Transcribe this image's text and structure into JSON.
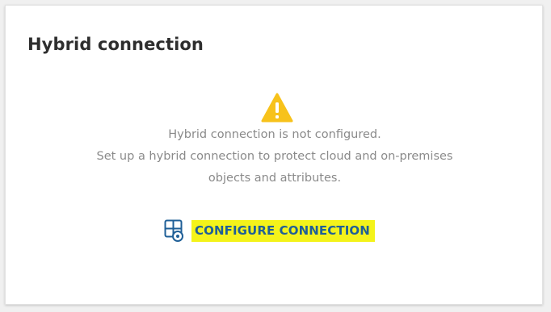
{
  "card": {
    "title": "Hybrid connection"
  },
  "status": {
    "icon": "warning-icon",
    "line1": "Hybrid connection is not configured.",
    "line2": "Set up a hybrid connection to protect cloud and on-premises",
    "line3": "objects and attributes."
  },
  "action": {
    "icon": "configure-connection-icon",
    "label": "CONFIGURE CONNECTION",
    "highlight_color": "#f4f31a",
    "link_color": "#1f5f97"
  },
  "colors": {
    "warning": "#f7c21b"
  }
}
